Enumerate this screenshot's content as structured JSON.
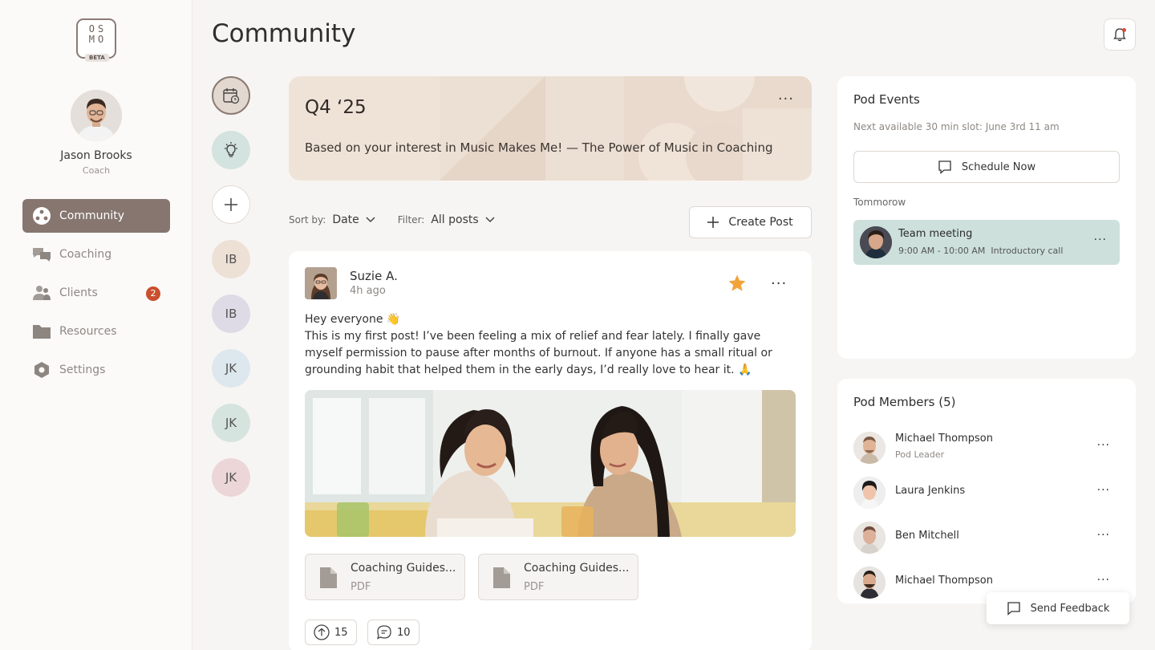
{
  "app": {
    "logo_text": "OSMO",
    "logo_badge": "BETA",
    "page_title": "Community"
  },
  "user": {
    "name": "Jason Brooks",
    "role": "Coach"
  },
  "sidebar": {
    "items": [
      {
        "label": "Community",
        "icon": "community-icon",
        "active": true
      },
      {
        "label": "Coaching",
        "icon": "chat-bubbles-icon"
      },
      {
        "label": "Clients",
        "icon": "users-icon",
        "badge": "2"
      },
      {
        "label": "Resources",
        "icon": "folder-icon"
      },
      {
        "label": "Settings",
        "icon": "gear-icon"
      }
    ]
  },
  "rail": {
    "items": [
      {
        "type": "icon",
        "icon": "calendar-clock-icon"
      },
      {
        "type": "icon",
        "icon": "lightbulb-icon"
      },
      {
        "type": "icon",
        "icon": "plus-icon"
      },
      {
        "type": "initials",
        "label": "IB",
        "color": "#ede0d5"
      },
      {
        "type": "initials",
        "label": "IB",
        "color": "#dedbe7"
      },
      {
        "type": "initials",
        "label": "JK",
        "color": "#dde8ee"
      },
      {
        "type": "initials",
        "label": "JK",
        "color": "#d6e4e0"
      },
      {
        "type": "initials",
        "label": "JK",
        "color": "#ecd6d8"
      }
    ]
  },
  "banner": {
    "title": "Q4 ‘25",
    "text": "Based on your interest in Music Makes Me! — The Power of Music in Coaching",
    "more": "···"
  },
  "toolbar": {
    "sort_label": "Sort by:",
    "sort_value": "Date",
    "filter_label": "Filter:",
    "filter_value": "All posts",
    "create_label": "Create Post"
  },
  "post": {
    "author": "Suzie A.",
    "time": "4h ago",
    "more": "···",
    "greeting": "Hey everyone 👋",
    "body": "This is my first post! I’ve been feeling a mix of relief and fear lately. I finally gave myself permission to pause after months of burnout. If anyone has a small ritual or grounding habit that helped them in the early days, I’d really love to hear it.  🙏",
    "attachments": [
      {
        "name": "Coaching Guides...",
        "type": "PDF"
      },
      {
        "name": "Coaching Guides...",
        "type": "PDF"
      }
    ],
    "upvotes": "15",
    "comments": "10"
  },
  "events": {
    "title": "Pod Events",
    "subtitle": "Next available 30 min slot: June 3rd 11 am",
    "schedule_label": "Schedule Now",
    "day_label": "Tommorow",
    "event": {
      "title": "Team meeting",
      "time": "9:00 AM - 10:00 AM",
      "type": "Introductory call",
      "more": "···"
    }
  },
  "members": {
    "title": "Pod Members (5)",
    "list": [
      {
        "name": "Michael Thompson",
        "role": "Pod Leader",
        "more": "···"
      },
      {
        "name": "Laura Jenkins",
        "role": "",
        "more": "···"
      },
      {
        "name": "Ben Mitchell",
        "role": "",
        "more": "···"
      },
      {
        "name": "Michael Thompson",
        "role": "",
        "more": "···"
      }
    ]
  },
  "feedback": {
    "label": "Send Feedback"
  },
  "colors": {
    "accent": "#86766f",
    "badge": "#c9502f",
    "star": "#f2a33a",
    "event_bg": "#cde0dc",
    "banner_bg": "#efe3d8"
  }
}
